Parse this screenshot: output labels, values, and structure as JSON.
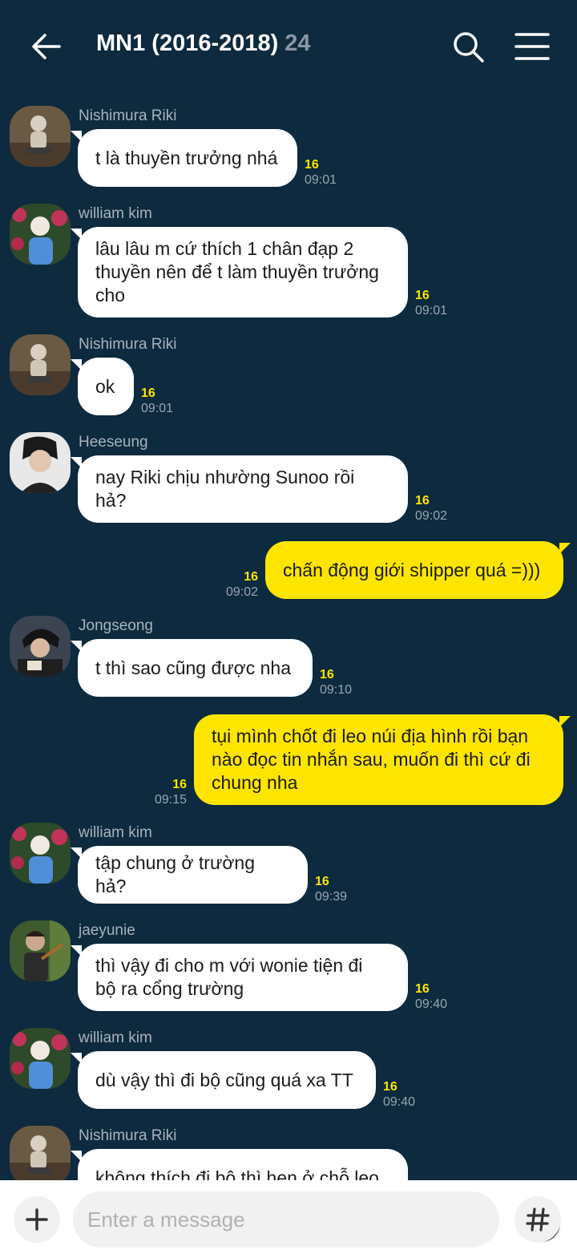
{
  "header": {
    "title": "MN1 (2016-2018)",
    "member_count": "24"
  },
  "messages": [
    {
      "sender": "Nishimura Riki",
      "text": "t là thuyền trưởng nhá",
      "unread": "16",
      "time": "09:01",
      "mine": false,
      "avatar": "avatar-riki"
    },
    {
      "sender": "william kim",
      "text": "lâu lâu m cứ thích 1 chân đạp 2\nthuyền nên để t làm thuyền trưởng\ncho",
      "unread": "16",
      "time": "09:01",
      "mine": false,
      "avatar": "avatar-william"
    },
    {
      "sender": "Nishimura Riki",
      "text": "ok",
      "unread": "16",
      "time": "09:01",
      "mine": false,
      "avatar": "avatar-riki"
    },
    {
      "sender": "Heeseung",
      "text": "nay Riki chịu nhường Sunoo rồi\nhả?",
      "unread": "16",
      "time": "09:02",
      "mine": false,
      "avatar": "avatar-heeseung"
    },
    {
      "sender": "",
      "text": "chấn động giới shipper quá =)))",
      "unread": "16",
      "time": "09:02",
      "mine": true
    },
    {
      "sender": "Jongseong",
      "text": "t thì sao cũng được nha",
      "unread": "16",
      "time": "09:10",
      "mine": false,
      "avatar": "avatar-jongseong"
    },
    {
      "sender": "",
      "text": "tụi mình chốt đi leo núi địa hình rồi bạn\nnào đọc tin nhắn sau, muốn đi thì cứ đi\nchung nha",
      "unread": "16",
      "time": "09:15",
      "mine": true
    },
    {
      "sender": "william kim",
      "text": "tập chung ở trường hả?",
      "unread": "16",
      "time": "09:39",
      "mine": false,
      "avatar": "avatar-william"
    },
    {
      "sender": "jaeyunie",
      "text": "thì vậy đi cho m với wonie tiện đi\nbộ ra cổng trường",
      "unread": "16",
      "time": "09:40",
      "mine": false,
      "avatar": "avatar-jaeyunie"
    },
    {
      "sender": "william kim",
      "text": "dù vậy thì đi bộ cũng quá xa TT",
      "unread": "16",
      "time": "09:40",
      "mine": false,
      "avatar": "avatar-william"
    },
    {
      "sender": "Nishimura Riki",
      "text": "không thích đi bộ thì hẹn ở chỗ leo",
      "unread": "",
      "time": "",
      "mine": false,
      "avatar": "avatar-riki"
    }
  ],
  "input": {
    "placeholder": "Enter a message"
  },
  "colors": {
    "background": "#0d2a3e",
    "my_bubble": "#fee500",
    "other_bubble": "#ffffff",
    "unread": "#fee500"
  },
  "icons": {
    "back": "arrow-left-icon",
    "search": "search-icon",
    "menu": "hamburger-menu-icon",
    "add": "plus-icon",
    "emoji": "smiley-icon",
    "hashtag": "hash-icon"
  }
}
